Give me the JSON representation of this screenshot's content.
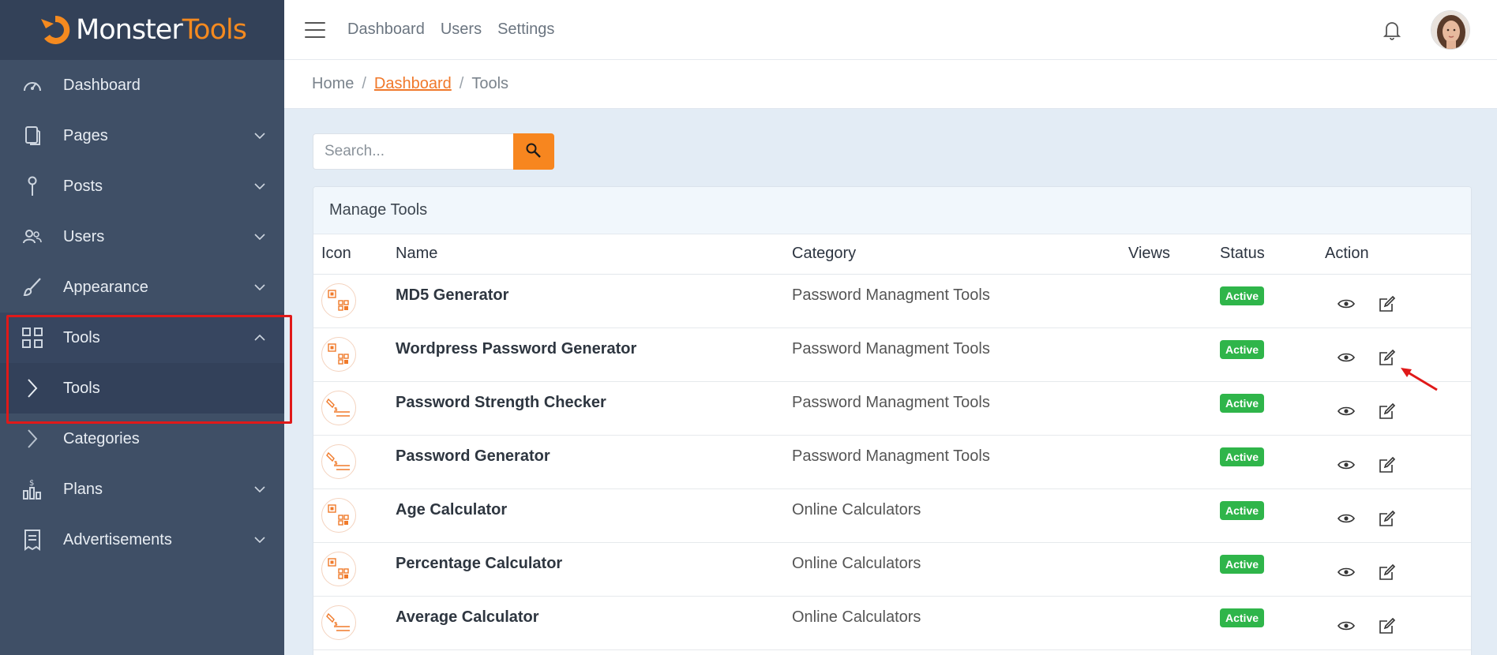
{
  "brand": {
    "part1": "Monster",
    "part2": "Tools"
  },
  "sidebar": {
    "items": [
      {
        "label": "Dashboard",
        "icon": "gauge-icon",
        "chevron": "none"
      },
      {
        "label": "Pages",
        "icon": "pages-icon",
        "chevron": "down"
      },
      {
        "label": "Posts",
        "icon": "pin-icon",
        "chevron": "down"
      },
      {
        "label": "Users",
        "icon": "users-icon",
        "chevron": "down"
      },
      {
        "label": "Appearance",
        "icon": "brush-icon",
        "chevron": "down"
      },
      {
        "label": "Tools",
        "icon": "grid-icon",
        "chevron": "up"
      },
      {
        "label": "Tools",
        "icon": "chevron-right-icon",
        "chevron": "none"
      },
      {
        "label": "Categories",
        "icon": "chevron-right-icon",
        "chevron": "none"
      },
      {
        "label": "Plans",
        "icon": "plans-icon",
        "chevron": "down"
      },
      {
        "label": "Advertisements",
        "icon": "receipt-icon",
        "chevron": "down"
      }
    ]
  },
  "topbar": {
    "links": [
      "Dashboard",
      "Users",
      "Settings"
    ]
  },
  "breadcrumb": {
    "home": "Home",
    "current_link": "Dashboard",
    "page": "Tools"
  },
  "search": {
    "placeholder": "Search..."
  },
  "card": {
    "title": "Manage Tools"
  },
  "table": {
    "headers": [
      "Icon",
      "Name",
      "Category",
      "Views",
      "Status",
      "Action"
    ],
    "rows": [
      {
        "icon": "qr-icon",
        "name": "MD5 Generator",
        "category": "Password Managment Tools",
        "views": "",
        "status": "Active"
      },
      {
        "icon": "qr-icon",
        "name": "Wordpress Password Generator",
        "category": "Password Managment Tools",
        "views": "",
        "status": "Active"
      },
      {
        "icon": "pen-lines-icon",
        "name": "Password Strength Checker",
        "category": "Password Managment Tools",
        "views": "",
        "status": "Active"
      },
      {
        "icon": "pen-lines-icon",
        "name": "Password Generator",
        "category": "Password Managment Tools",
        "views": "",
        "status": "Active"
      },
      {
        "icon": "qr-icon",
        "name": "Age Calculator",
        "category": "Online Calculators",
        "views": "",
        "status": "Active"
      },
      {
        "icon": "qr-icon",
        "name": "Percentage Calculator",
        "category": "Online Calculators",
        "views": "",
        "status": "Active"
      },
      {
        "icon": "pen-lines-icon",
        "name": "Average Calculator",
        "category": "Online Calculators",
        "views": "",
        "status": "Active"
      }
    ]
  },
  "colors": {
    "accent": "#f7861f",
    "sidebar": "#3f4f66",
    "active_badge": "#2fb54a",
    "highlight": "#e01919"
  }
}
